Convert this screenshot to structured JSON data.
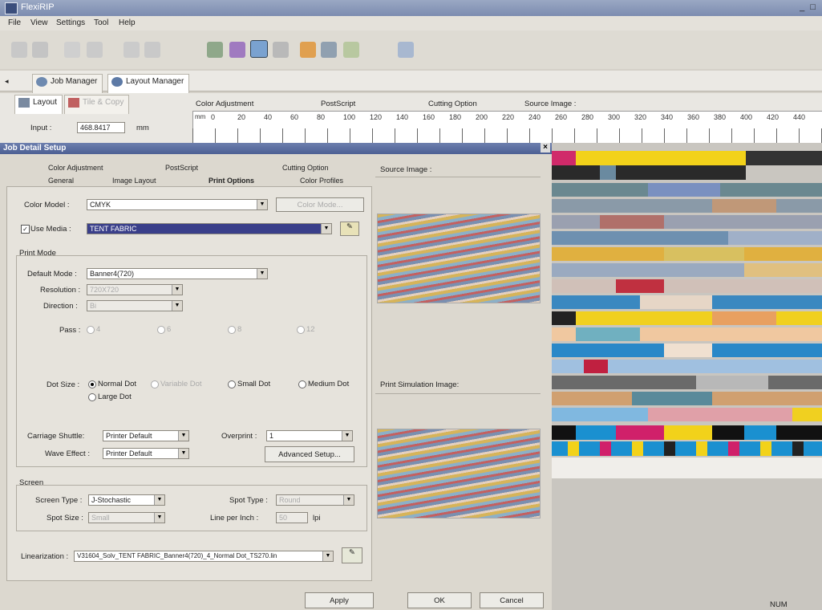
{
  "app": {
    "title": "FlexiRIP"
  },
  "menu": [
    "File",
    "View",
    "Settings",
    "Tool",
    "Help"
  ],
  "main_tabs": [
    {
      "label": "Job Manager"
    },
    {
      "label": "Layout Manager"
    }
  ],
  "sub_tabs": [
    {
      "label": "Layout"
    },
    {
      "label": "Tile & Copy"
    }
  ],
  "header_tabs": [
    "Color Adjustment",
    "PostScript",
    "Cutting Option",
    "Source Image :"
  ],
  "input": {
    "label": "Input :",
    "value": "468.8417",
    "unit": "mm"
  },
  "ruler_labels": [
    "0",
    "20",
    "40",
    "60",
    "80",
    "100",
    "120",
    "140",
    "160",
    "180",
    "200",
    "220",
    "240",
    "260",
    "280",
    "300",
    "320",
    "340",
    "360",
    "380",
    "400",
    "420",
    "440"
  ],
  "dialog": {
    "title": "Job Detail Setup",
    "tabs_row1": [
      "Color Adjustment",
      "PostScript",
      "Cutting Option"
    ],
    "tabs_row2": [
      "General",
      "Image Layout",
      "Print Options",
      "Color Profiles"
    ],
    "color_model": {
      "label": "Color Model :",
      "value": "CMYK",
      "button": "Color Mode..."
    },
    "use_media": {
      "label": "Use Media :",
      "value": "TENT FABRIC",
      "checked": true
    },
    "print_mode": {
      "group": "Print Mode",
      "default_mode_label": "Default Mode :",
      "default_mode_value": "Banner4(720)",
      "resolution_label": "Resolution :",
      "resolution_value": "720X720",
      "direction_label": "Direction :",
      "direction_value": "Bi",
      "pass_label": "Pass :",
      "pass_options": [
        "4",
        "6",
        "8",
        "12"
      ]
    },
    "dot_size": {
      "label": "Dot Size :",
      "options": [
        "Normal Dot",
        "Variable Dot",
        "Small Dot",
        "Medium Dot",
        "Large Dot"
      ],
      "selected": "Normal Dot"
    },
    "carriage_label": "Carriage Shuttle:",
    "carriage_value": "Printer Default",
    "overprint_label": "Overprint :",
    "overprint_value": "1",
    "wave_label": "Wave Effect :",
    "wave_value": "Printer Default",
    "advanced_button": "Advanced Setup...",
    "screen": {
      "group": "Screen",
      "type_label": "Screen Type :",
      "type_value": "J-Stochastic",
      "spot_type_label": "Spot Type :",
      "spot_type_value": "Round",
      "spot_size_label": "Spot Size :",
      "spot_size_value": "Small",
      "lpi_label": "Line per Inch :",
      "lpi_value": "50",
      "lpi_unit": "lpi"
    },
    "linearization_label": "Linearization :",
    "linearization_value": "V31604_Solv_TENT FABRIC_Banner4(720)_4_Normal Dot_TS270.lin",
    "source_image_label": "Source Image :",
    "print_sim_label": "Print Simulation Image:",
    "buttons": {
      "apply": "Apply",
      "ok": "OK",
      "cancel": "Cancel"
    }
  },
  "status": {
    "num": "NUM"
  },
  "colors": {
    "accent": "#4c5f93",
    "media_highlight": "#3a3f8a"
  }
}
